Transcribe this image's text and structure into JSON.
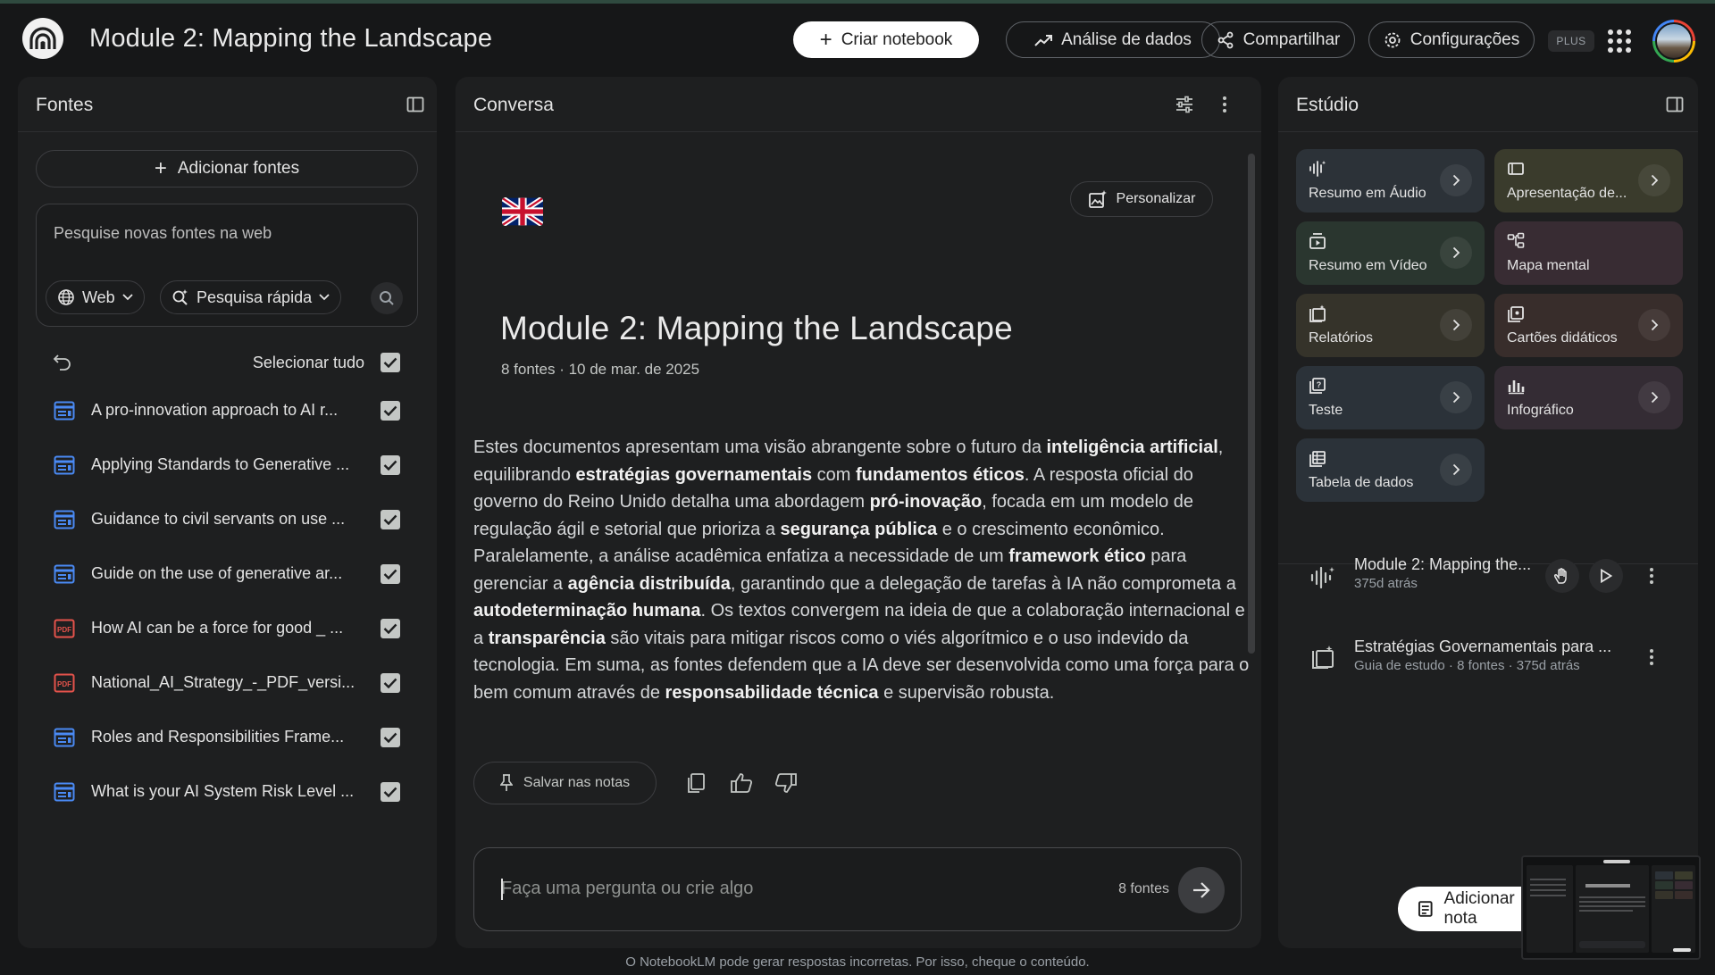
{
  "header": {
    "title": "Module 2: Mapping the Landscape",
    "create_label": "Criar notebook",
    "analytics_label": "Análise de dados",
    "share_label": "Compartilhar",
    "settings_label": "Configurações",
    "plan_badge": "PLUS"
  },
  "sources": {
    "title": "Fontes",
    "add_label": "Adicionar fontes",
    "search_placeholder": "Pesquise novas fontes na web",
    "web_chip": "Web",
    "mode_chip": "Pesquisa rápida",
    "select_all": "Selecionar tudo",
    "items": [
      {
        "label": "A pro-innovation approach to AI r...",
        "type": "web"
      },
      {
        "label": "Applying Standards to Generative ...",
        "type": "web"
      },
      {
        "label": "Guidance to civil servants on use ...",
        "type": "web"
      },
      {
        "label": "Guide on the use of generative ar...",
        "type": "web"
      },
      {
        "label": "How AI can be a force for good _ ...",
        "type": "pdf"
      },
      {
        "label": "National_AI_Strategy_-_PDF_versi...",
        "type": "pdf"
      },
      {
        "label": "Roles and Responsibilities Frame...",
        "type": "web"
      },
      {
        "label": "What is your AI System Risk Level ...",
        "type": "web"
      }
    ]
  },
  "chat": {
    "title": "Conversa",
    "personalize_label": "Personalizar",
    "notebook_title": "Module 2: Mapping the Landscape",
    "meta": "8 fontes · 10 de mar. de 2025",
    "summary_parts": [
      {
        "t": "Estes documentos apresentam uma visão abrangente sobre o futuro da ",
        "b": false
      },
      {
        "t": "inteligência artificial",
        "b": true
      },
      {
        "t": ", equilibrando ",
        "b": false
      },
      {
        "t": "estratégias governamentais",
        "b": true
      },
      {
        "t": " com ",
        "b": false
      },
      {
        "t": "fundamentos éticos",
        "b": true
      },
      {
        "t": ". A resposta oficial do governo do Reino Unido detalha uma abordagem ",
        "b": false
      },
      {
        "t": "pró-inovação",
        "b": true
      },
      {
        "t": ", focada em um modelo de regulação ágil e setorial que prioriza a ",
        "b": false
      },
      {
        "t": "segurança pública",
        "b": true
      },
      {
        "t": " e o crescimento econômico. Paralelamente, a análise acadêmica enfatiza a necessidade de um ",
        "b": false
      },
      {
        "t": "framework ético",
        "b": true
      },
      {
        "t": " para gerenciar a ",
        "b": false
      },
      {
        "t": "agência distribuída",
        "b": true
      },
      {
        "t": ", garantindo que a delegação de tarefas à IA não comprometa a ",
        "b": false
      },
      {
        "t": "autodeterminação humana",
        "b": true
      },
      {
        "t": ". Os textos convergem na ideia de que a colaboração internacional e a ",
        "b": false
      },
      {
        "t": "transparência",
        "b": true
      },
      {
        "t": " são vitais para mitigar riscos como o viés algorítmico e o uso indevido da tecnologia. Em suma, as fontes defendem que a IA deve ser desenvolvida como uma força para o bem comum através de ",
        "b": false
      },
      {
        "t": "responsabilidade técnica",
        "b": true
      },
      {
        "t": " e supervisão robusta.",
        "b": false
      }
    ],
    "save_label": "Salvar nas notas",
    "input_placeholder": "Faça uma pergunta ou crie algo",
    "source_count": "8 fontes",
    "footer": "O NotebookLM pode gerar respostas incorretas. Por isso, cheque o conteúdo."
  },
  "studio": {
    "title": "Estúdio",
    "tiles": [
      {
        "label": "Resumo em Áudio",
        "icon": "audio-icon",
        "color": "#2c3238",
        "arrow": true
      },
      {
        "label": "Apresentação de...",
        "icon": "slides-icon",
        "color": "#3a3b2c",
        "arrow": true
      },
      {
        "label": "Resumo em Vídeo",
        "icon": "video-icon",
        "color": "#2a362f",
        "arrow": true
      },
      {
        "label": "Mapa mental",
        "icon": "mindmap-icon",
        "color": "#382c33",
        "arrow": false
      },
      {
        "label": "Relatórios",
        "icon": "report-icon",
        "color": "#35332a",
        "arrow": true
      },
      {
        "label": "Cartões didáticos",
        "icon": "flashcards-icon",
        "color": "#382d2b",
        "arrow": true
      },
      {
        "label": "Teste",
        "icon": "quiz-icon",
        "color": "#2b3239",
        "arrow": true
      },
      {
        "label": "Infográfico",
        "icon": "infographic-icon",
        "color": "#342c34",
        "arrow": true
      },
      {
        "label": "Tabela de dados",
        "icon": "table-icon",
        "color": "#2b3239",
        "arrow": true
      }
    ],
    "notes": [
      {
        "title": "Module 2: Mapping the...",
        "subtitle": "375d atrás"
      },
      {
        "title": "Estratégias Governamentais para ...",
        "subtitle": "Guia de estudo · 8 fontes · 375d atrás"
      }
    ],
    "add_note_label": "Adicionar nota"
  }
}
